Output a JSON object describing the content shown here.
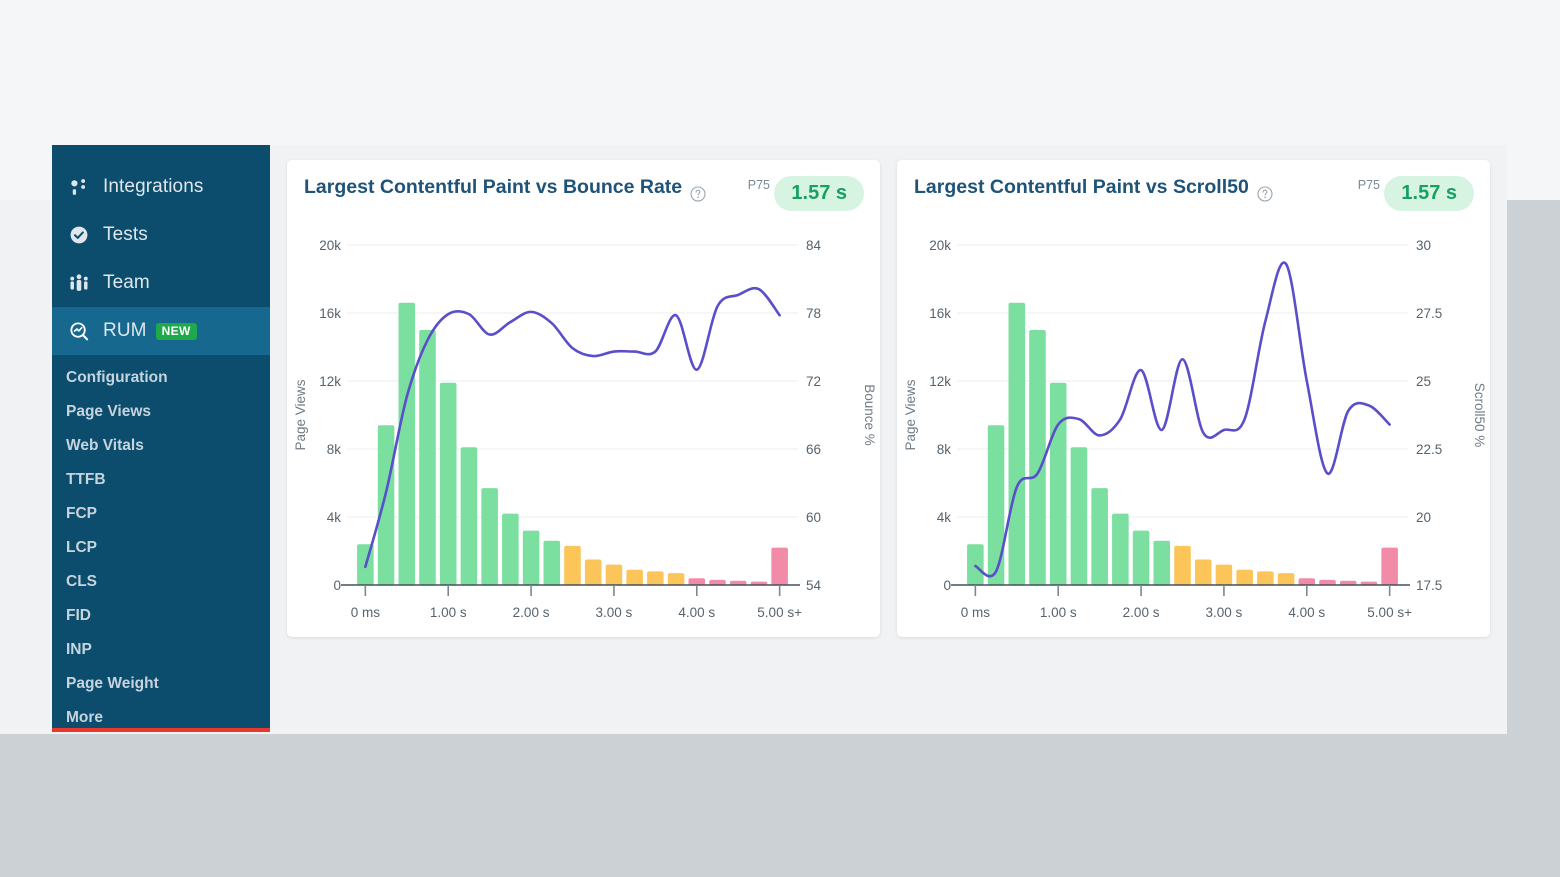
{
  "sidebar": {
    "main_items": [
      {
        "label": "Integrations",
        "icon": "integrations-icon",
        "active": false,
        "badge": null
      },
      {
        "label": "Tests",
        "icon": "check-circle-icon",
        "active": false,
        "badge": null
      },
      {
        "label": "Team",
        "icon": "team-icon",
        "active": false,
        "badge": null
      },
      {
        "label": "RUM",
        "icon": "rum-search-icon",
        "active": true,
        "badge": "NEW"
      }
    ],
    "sub_items": [
      {
        "label": "Configuration"
      },
      {
        "label": "Page Views"
      },
      {
        "label": "Web Vitals"
      },
      {
        "label": "TTFB"
      },
      {
        "label": "FCP"
      },
      {
        "label": "LCP"
      },
      {
        "label": "CLS"
      },
      {
        "label": "FID"
      },
      {
        "label": "INP"
      },
      {
        "label": "Page Weight"
      },
      {
        "label": "More"
      }
    ],
    "colors": {
      "background": "#0c4c6c",
      "active": "#16688f",
      "underline": "#e8372b",
      "badge_new": "#1fa94c"
    }
  },
  "cards": [
    {
      "title": "Largest Contentful Paint vs Bounce Rate",
      "help_icon": "question-circle-icon",
      "p75_label": "P75",
      "p75_value": "1.57 s"
    },
    {
      "title": "Largest Contentful Paint vs Scroll50",
      "help_icon": "question-circle-icon",
      "p75_label": "P75",
      "p75_value": "1.57 s"
    }
  ],
  "chart_data": [
    {
      "type": "bar",
      "title": "Largest Contentful Paint vs Bounce Rate",
      "xlabel": "",
      "ylabel": "Page Views",
      "y2label": "Bounce %",
      "x_tick_labels": [
        "0 ms",
        "1.00 s",
        "2.00 s",
        "3.00 s",
        "4.00 s",
        "5.00 s+"
      ],
      "x_tick_values": [
        0,
        1,
        2,
        3,
        4,
        5
      ],
      "xlim": [
        -0.125,
        5.125
      ],
      "y_tick_labels": [
        "0",
        "4k",
        "8k",
        "12k",
        "16k",
        "20k"
      ],
      "ylim": [
        0,
        20000
      ],
      "y2_tick_labels": [
        "54",
        "60",
        "66",
        "72",
        "78",
        "84"
      ],
      "y2lim": [
        54,
        84
      ],
      "grid": true,
      "legend": "none",
      "bin_width_s": 0.25,
      "bar_colors": {
        "good": "#7bdfa0",
        "needs_improvement": "#fcc55a",
        "poor": "#f28ba8"
      },
      "series": [
        {
          "name": "Page Views",
          "kind": "bar",
          "x": [
            0.0,
            0.25,
            0.5,
            0.75,
            1.0,
            1.25,
            1.5,
            1.75,
            2.0,
            2.25,
            2.5,
            2.75,
            3.0,
            3.25,
            3.5,
            3.75,
            4.0,
            4.25,
            4.5,
            4.75,
            5.0
          ],
          "values": [
            2400,
            9400,
            16600,
            15000,
            11900,
            8100,
            5700,
            4200,
            3200,
            2600,
            2300,
            1500,
            1200,
            900,
            800,
            700,
            400,
            300,
            250,
            200,
            2200
          ],
          "bucket": [
            "good",
            "good",
            "good",
            "good",
            "good",
            "good",
            "good",
            "good",
            "good",
            "good",
            "needs_improvement",
            "needs_improvement",
            "needs_improvement",
            "needs_improvement",
            "needs_improvement",
            "needs_improvement",
            "poor",
            "poor",
            "poor",
            "poor",
            "poor"
          ]
        },
        {
          "name": "Bounce %",
          "kind": "line",
          "color": "#5a4ecb",
          "x": [
            0.0,
            0.25,
            0.5,
            0.75,
            1.0,
            1.25,
            1.5,
            1.75,
            2.0,
            2.25,
            2.5,
            2.75,
            3.0,
            3.25,
            3.5,
            3.75,
            4.0,
            4.25,
            4.5,
            4.75,
            5.0
          ],
          "values": [
            55.6,
            62.2,
            70.6,
            75.6,
            77.9,
            77.9,
            76.1,
            77.2,
            78.1,
            77.1,
            74.9,
            74.2,
            74.6,
            74.6,
            74.6,
            77.8,
            73.0,
            78.6,
            79.6,
            80.1,
            77.8
          ]
        }
      ]
    },
    {
      "type": "bar",
      "title": "Largest Contentful Paint vs Scroll50",
      "xlabel": "",
      "ylabel": "Page Views",
      "y2label": "Scroll50 %",
      "x_tick_labels": [
        "0 ms",
        "1.00 s",
        "2.00 s",
        "3.00 s",
        "4.00 s",
        "5.00 s+"
      ],
      "x_tick_values": [
        0,
        1,
        2,
        3,
        4,
        5
      ],
      "xlim": [
        -0.125,
        5.125
      ],
      "y_tick_labels": [
        "0",
        "4k",
        "8k",
        "12k",
        "16k",
        "20k"
      ],
      "ylim": [
        0,
        20000
      ],
      "y2_tick_labels": [
        "17.5",
        "20",
        "22.5",
        "25",
        "27.5",
        "30"
      ],
      "y2lim": [
        17.5,
        30
      ],
      "grid": true,
      "legend": "none",
      "bin_width_s": 0.25,
      "bar_colors": {
        "good": "#7bdfa0",
        "needs_improvement": "#fcc55a",
        "poor": "#f28ba8"
      },
      "series": [
        {
          "name": "Page Views",
          "kind": "bar",
          "x": [
            0.0,
            0.25,
            0.5,
            0.75,
            1.0,
            1.25,
            1.5,
            1.75,
            2.0,
            2.25,
            2.5,
            2.75,
            3.0,
            3.25,
            3.5,
            3.75,
            4.0,
            4.25,
            4.5,
            4.75,
            5.0
          ],
          "values": [
            2400,
            9400,
            16600,
            15000,
            11900,
            8100,
            5700,
            4200,
            3200,
            2600,
            2300,
            1500,
            1200,
            900,
            800,
            700,
            400,
            300,
            250,
            200,
            2200
          ],
          "bucket": [
            "good",
            "good",
            "good",
            "good",
            "good",
            "good",
            "good",
            "good",
            "good",
            "good",
            "needs_improvement",
            "needs_improvement",
            "needs_improvement",
            "needs_improvement",
            "needs_improvement",
            "needs_improvement",
            "poor",
            "poor",
            "poor",
            "poor",
            "poor"
          ]
        },
        {
          "name": "Scroll50 %",
          "kind": "line",
          "color": "#5a4ecb",
          "x": [
            0.0,
            0.25,
            0.5,
            0.75,
            1.0,
            1.25,
            1.5,
            1.75,
            2.0,
            2.25,
            2.5,
            2.75,
            3.0,
            3.25,
            3.5,
            3.75,
            4.0,
            4.25,
            4.5,
            4.75,
            5.0
          ],
          "values": [
            18.2,
            18.0,
            21.1,
            21.6,
            23.4,
            23.6,
            23.0,
            23.6,
            25.4,
            23.2,
            25.8,
            23.1,
            23.2,
            23.6,
            27.2,
            29.3,
            25.0,
            21.6,
            23.9,
            24.1,
            23.4
          ]
        }
      ]
    }
  ]
}
